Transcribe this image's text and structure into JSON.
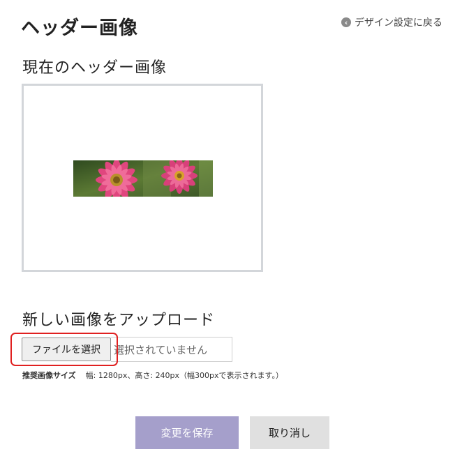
{
  "page": {
    "title": "ヘッダー画像",
    "back_link_label": "デザイン設定に戻る"
  },
  "current": {
    "section_title": "現在のヘッダー画像"
  },
  "upload": {
    "section_title": "新しい画像をアップロード",
    "file_button_label": "ファイルを選択",
    "file_status": "選択されていません",
    "size_hint_label": "推奨画像サイズ",
    "size_hint_text": "幅: 1280px、高さ: 240px（幅300pxで表示されます。）"
  },
  "actions": {
    "save_label": "変更を保存",
    "cancel_label": "取り消し"
  },
  "icons": {
    "back": "arrow-left-circle-icon"
  },
  "colors": {
    "save_button": "#a59fcb",
    "cancel_button": "#e0e0e0",
    "preview_border": "#d3d6da",
    "highlight": "#e02020"
  }
}
